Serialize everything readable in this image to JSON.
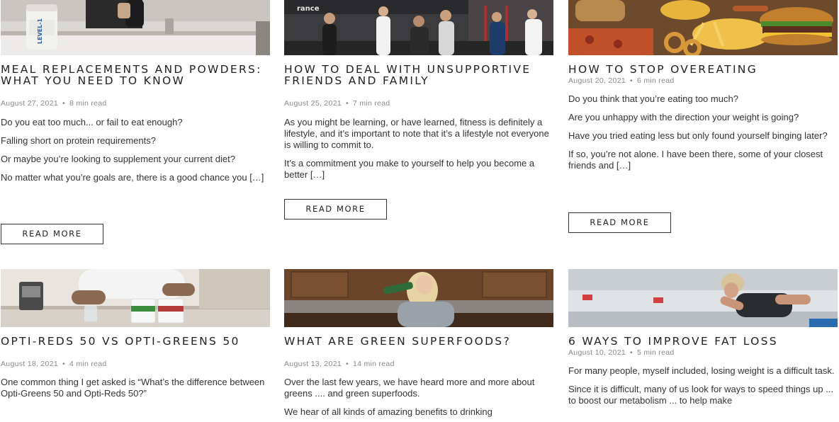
{
  "posts": [
    {
      "title": "Meal Replacements and Powders: What You Need to Know",
      "date": "August 27, 2021",
      "read_time": "8 min read",
      "paragraphs": [
        "Do you eat too much... or fail to eat enough?",
        "Falling short on protein requirements?",
        "Or maybe you’re looking to supplement your current diet?",
        "No matter what you’re goals are, there is a good chance you […]"
      ],
      "button": "READ MORE",
      "image_label": "LEVEL-1"
    },
    {
      "title": "How to Deal With Unsupportive Friends and Family",
      "date": "August 25, 2021",
      "read_time": "7 min read",
      "paragraphs": [
        "As you might be learning,  or have learned, fitness is definitely a lifestyle, and it’s important to note that it’s a lifestyle not everyone is willing to commit to.",
        "It’s a commitment you make to yourself to help you become a better […]"
      ],
      "button": "READ MORE",
      "image_label": "rance"
    },
    {
      "title": "How to Stop Overeating",
      "date": "August 20, 2021",
      "read_time": "6 min read",
      "paragraphs": [
        "Do you think that you’re eating too much?",
        "Are you unhappy with the direction your weight is going?",
        "Have you tried eating less but only found yourself binging later?",
        "If so, you’re not alone. I have been there, some of your closest friends and […]"
      ],
      "button": "READ MORE"
    },
    {
      "title": "Opti-Reds 50 vs Opti-Greens 50",
      "date": "August 18, 2021",
      "read_time": "4 min read",
      "paragraphs": [
        "One common thing I get asked is “What’s the difference between Opti-Greens 50 and Opti-Reds 50?”"
      ]
    },
    {
      "title": "What are Green Superfoods?",
      "date": "August 13, 2021",
      "read_time": "14 min read",
      "paragraphs": [
        "Over the last few years, we have heard more and more about greens .... and green superfoods.",
        "We hear of all kinds of amazing benefits to drinking"
      ]
    },
    {
      "title": "6 Ways to Improve Fat Loss",
      "date": "August 10, 2021",
      "read_time": "5 min read",
      "paragraphs": [
        "For many people, myself included, losing weight is a difficult task.",
        "Since it is difficult, many of us look for ways to speed things up ... to boost our metabolism ... to help make"
      ]
    }
  ]
}
